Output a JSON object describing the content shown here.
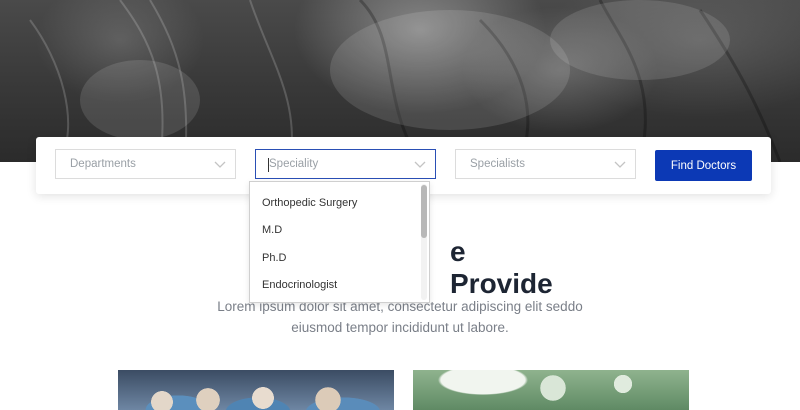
{
  "search": {
    "departments_placeholder": "Departments",
    "speciality_placeholder": "Speciality",
    "specialists_placeholder": "Specialists",
    "find_button_label": "Find Doctors"
  },
  "speciality_dropdown": {
    "options": [
      "Orthopedic Surgery",
      "M.D",
      "Ph.D",
      "Endocrinologist"
    ]
  },
  "section": {
    "title": "e Provide",
    "description_line1": "Lorem ipsum dolor sit amet, consectetur adipiscing elit seddo",
    "description_line2": "eiusmod tempor incididunt ut labore."
  },
  "colors": {
    "primary": "#0c39b5",
    "focus_border": "#2a4fb5",
    "title": "#1d2533",
    "muted_text": "#7a7f88"
  },
  "icons": {
    "chevron": "chevron-down-icon"
  }
}
